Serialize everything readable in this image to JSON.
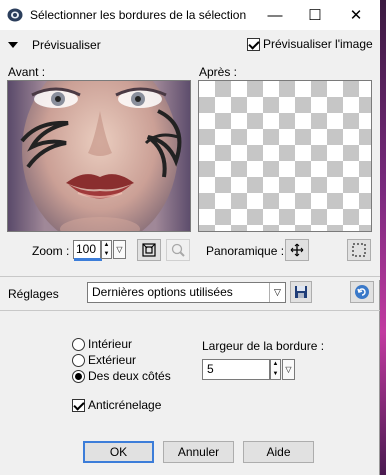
{
  "window": {
    "title": "Sélectionner les bordures de la sélection"
  },
  "titlebar": {
    "minimize_glyph": "—",
    "maximize_glyph": "☐",
    "close_glyph": "✕"
  },
  "preview": {
    "toggle_label": "Prévisualiser",
    "preview_image_label": "Prévisualiser l'image",
    "preview_image_checked": true,
    "before_label": "Avant :",
    "after_label": "Après :"
  },
  "zoom": {
    "label": "Zoom :",
    "value": "100"
  },
  "pan": {
    "label": "Panoramique :"
  },
  "settings": {
    "label": "Réglages",
    "selected": "Dernières options utilisées"
  },
  "options": {
    "radios": [
      {
        "label": "Intérieur",
        "checked": false
      },
      {
        "label": "Extérieur",
        "checked": false
      },
      {
        "label": "Des deux côtés",
        "checked": true
      }
    ],
    "antialias_label": "Anticrénelage",
    "antialias_checked": true,
    "border_width_label": "Largeur de la bordure :",
    "border_width_value": "5"
  },
  "buttons": {
    "ok": "OK",
    "cancel": "Annuler",
    "help": "Aide"
  },
  "icons": [
    "app-icon",
    "fit-window-icon",
    "zoom-reset-icon",
    "pan-move-icon",
    "selection-marquee-icon",
    "save-preset-icon",
    "reset-icon"
  ]
}
